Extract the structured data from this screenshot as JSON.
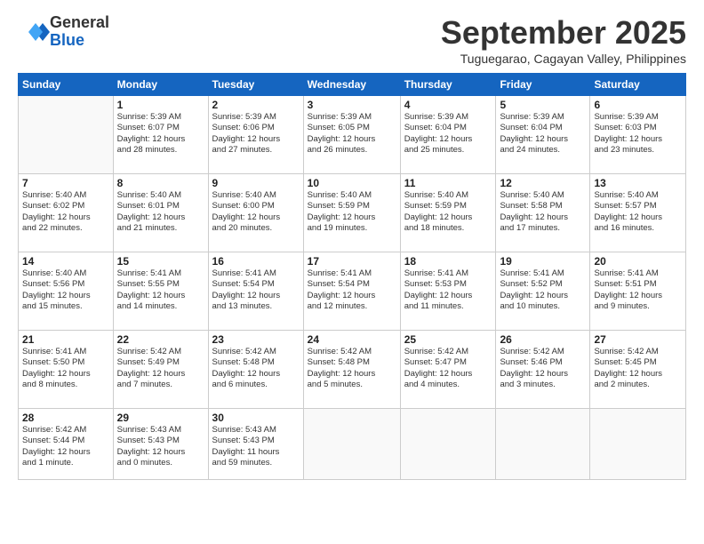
{
  "logo": {
    "general": "General",
    "blue": "Blue"
  },
  "title": "September 2025",
  "subtitle": "Tuguegarao, Cagayan Valley, Philippines",
  "headers": [
    "Sunday",
    "Monday",
    "Tuesday",
    "Wednesday",
    "Thursday",
    "Friday",
    "Saturday"
  ],
  "weeks": [
    [
      {
        "day": "",
        "info": ""
      },
      {
        "day": "1",
        "info": "Sunrise: 5:39 AM\nSunset: 6:07 PM\nDaylight: 12 hours\nand 28 minutes."
      },
      {
        "day": "2",
        "info": "Sunrise: 5:39 AM\nSunset: 6:06 PM\nDaylight: 12 hours\nand 27 minutes."
      },
      {
        "day": "3",
        "info": "Sunrise: 5:39 AM\nSunset: 6:05 PM\nDaylight: 12 hours\nand 26 minutes."
      },
      {
        "day": "4",
        "info": "Sunrise: 5:39 AM\nSunset: 6:04 PM\nDaylight: 12 hours\nand 25 minutes."
      },
      {
        "day": "5",
        "info": "Sunrise: 5:39 AM\nSunset: 6:04 PM\nDaylight: 12 hours\nand 24 minutes."
      },
      {
        "day": "6",
        "info": "Sunrise: 5:39 AM\nSunset: 6:03 PM\nDaylight: 12 hours\nand 23 minutes."
      }
    ],
    [
      {
        "day": "7",
        "info": "Sunrise: 5:40 AM\nSunset: 6:02 PM\nDaylight: 12 hours\nand 22 minutes."
      },
      {
        "day": "8",
        "info": "Sunrise: 5:40 AM\nSunset: 6:01 PM\nDaylight: 12 hours\nand 21 minutes."
      },
      {
        "day": "9",
        "info": "Sunrise: 5:40 AM\nSunset: 6:00 PM\nDaylight: 12 hours\nand 20 minutes."
      },
      {
        "day": "10",
        "info": "Sunrise: 5:40 AM\nSunset: 5:59 PM\nDaylight: 12 hours\nand 19 minutes."
      },
      {
        "day": "11",
        "info": "Sunrise: 5:40 AM\nSunset: 5:59 PM\nDaylight: 12 hours\nand 18 minutes."
      },
      {
        "day": "12",
        "info": "Sunrise: 5:40 AM\nSunset: 5:58 PM\nDaylight: 12 hours\nand 17 minutes."
      },
      {
        "day": "13",
        "info": "Sunrise: 5:40 AM\nSunset: 5:57 PM\nDaylight: 12 hours\nand 16 minutes."
      }
    ],
    [
      {
        "day": "14",
        "info": "Sunrise: 5:40 AM\nSunset: 5:56 PM\nDaylight: 12 hours\nand 15 minutes."
      },
      {
        "day": "15",
        "info": "Sunrise: 5:41 AM\nSunset: 5:55 PM\nDaylight: 12 hours\nand 14 minutes."
      },
      {
        "day": "16",
        "info": "Sunrise: 5:41 AM\nSunset: 5:54 PM\nDaylight: 12 hours\nand 13 minutes."
      },
      {
        "day": "17",
        "info": "Sunrise: 5:41 AM\nSunset: 5:54 PM\nDaylight: 12 hours\nand 12 minutes."
      },
      {
        "day": "18",
        "info": "Sunrise: 5:41 AM\nSunset: 5:53 PM\nDaylight: 12 hours\nand 11 minutes."
      },
      {
        "day": "19",
        "info": "Sunrise: 5:41 AM\nSunset: 5:52 PM\nDaylight: 12 hours\nand 10 minutes."
      },
      {
        "day": "20",
        "info": "Sunrise: 5:41 AM\nSunset: 5:51 PM\nDaylight: 12 hours\nand 9 minutes."
      }
    ],
    [
      {
        "day": "21",
        "info": "Sunrise: 5:41 AM\nSunset: 5:50 PM\nDaylight: 12 hours\nand 8 minutes."
      },
      {
        "day": "22",
        "info": "Sunrise: 5:42 AM\nSunset: 5:49 PM\nDaylight: 12 hours\nand 7 minutes."
      },
      {
        "day": "23",
        "info": "Sunrise: 5:42 AM\nSunset: 5:48 PM\nDaylight: 12 hours\nand 6 minutes."
      },
      {
        "day": "24",
        "info": "Sunrise: 5:42 AM\nSunset: 5:48 PM\nDaylight: 12 hours\nand 5 minutes."
      },
      {
        "day": "25",
        "info": "Sunrise: 5:42 AM\nSunset: 5:47 PM\nDaylight: 12 hours\nand 4 minutes."
      },
      {
        "day": "26",
        "info": "Sunrise: 5:42 AM\nSunset: 5:46 PM\nDaylight: 12 hours\nand 3 minutes."
      },
      {
        "day": "27",
        "info": "Sunrise: 5:42 AM\nSunset: 5:45 PM\nDaylight: 12 hours\nand 2 minutes."
      }
    ],
    [
      {
        "day": "28",
        "info": "Sunrise: 5:42 AM\nSunset: 5:44 PM\nDaylight: 12 hours\nand 1 minute."
      },
      {
        "day": "29",
        "info": "Sunrise: 5:43 AM\nSunset: 5:43 PM\nDaylight: 12 hours\nand 0 minutes."
      },
      {
        "day": "30",
        "info": "Sunrise: 5:43 AM\nSunset: 5:43 PM\nDaylight: 11 hours\nand 59 minutes."
      },
      {
        "day": "",
        "info": ""
      },
      {
        "day": "",
        "info": ""
      },
      {
        "day": "",
        "info": ""
      },
      {
        "day": "",
        "info": ""
      }
    ]
  ]
}
